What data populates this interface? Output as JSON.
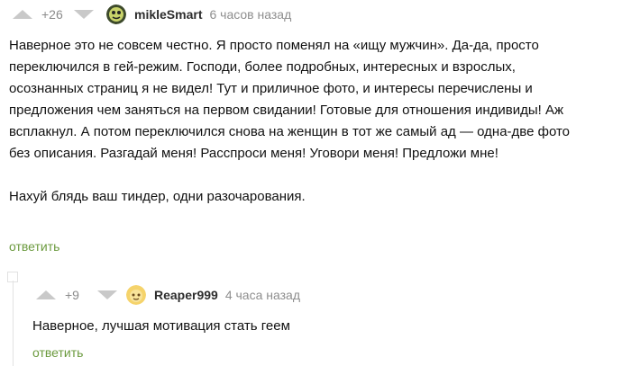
{
  "comment": {
    "rating": "+26",
    "author": "mikleSmart",
    "time": "6 часов назад",
    "paragraphs": [
      "Наверное это не совсем честно. Я просто поменял на «ищу мужчин». Да-да, просто",
      "переключился в гей-режим. Господи, более подробных, интересных и взрослых,",
      "осознанных страниц я не видел! Тут и приличное фото, и интересы перечислены и",
      "предложения чем заняться на первом свидании! Готовые для отношения индивиды! Аж",
      "всплакнул. А потом переключился снова на женщин в тот же самый ад — одна-две фото",
      "без описания. Разгадай меня! Расспроси меня! Уговори меня! Предложи мне!",
      "",
      "Нахуй блядь ваш тиндер, одни разочарования."
    ],
    "reply_label": "ответить",
    "avatar_icon": "cartoon-avatar-icon"
  },
  "reply": {
    "rating": "+9",
    "author": "Reaper999",
    "time": "4 часа назад",
    "text": "Наверное, лучшая мотивация стать геем",
    "reply_label": "ответить",
    "avatar_icon": "yellow-avatar-icon"
  },
  "colors": {
    "accent_green": "#6b9a3e",
    "vote_arrow": "#c9c9c9",
    "muted_text": "#8e8e8e"
  }
}
